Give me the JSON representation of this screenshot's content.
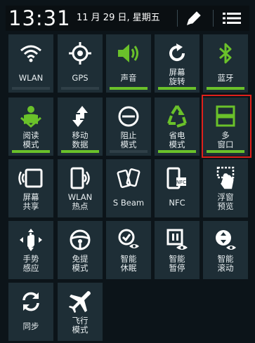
{
  "status": {
    "time": "13:31",
    "date": "11 月 29 日, 星期五"
  },
  "colors": {
    "active_bar": "#6ac12a",
    "inactive_bar": "#2f3f47",
    "tile_bg": "#1e2e36",
    "highlight": "#e0201b"
  },
  "tiles": [
    {
      "label": "WLAN",
      "icon": "wifi-icon",
      "active": false
    },
    {
      "label": "GPS",
      "icon": "gps-icon",
      "active": false
    },
    {
      "label": "声音",
      "icon": "sound-icon",
      "active": true
    },
    {
      "label": "屏幕\n旋转",
      "icon": "rotate-icon",
      "active": true
    },
    {
      "label": "蓝牙",
      "icon": "bluetooth-icon",
      "active": true
    },
    {
      "label": "阅读\n模式",
      "icon": "reading-icon",
      "active": true
    },
    {
      "label": "移动\n数据",
      "icon": "mobile-data-icon",
      "active": true
    },
    {
      "label": "阻止\n模式",
      "icon": "block-icon",
      "active": false
    },
    {
      "label": "省电\n模式",
      "icon": "recycle-icon",
      "active": true
    },
    {
      "label": "多\n窗口",
      "icon": "multi-window-icon",
      "active": true
    },
    {
      "label": "屏幕\n共享",
      "icon": "screen-share-icon",
      "active": false
    },
    {
      "label": "WLAN\n热点",
      "icon": "hotspot-icon",
      "active": false
    },
    {
      "label": "S Beam",
      "icon": "sbeam-icon",
      "active": false
    },
    {
      "label": "NFC",
      "icon": "nfc-icon",
      "active": false
    },
    {
      "label": "浮窗\n预览",
      "icon": "float-preview-icon",
      "active": false
    },
    {
      "label": "手势\n感应",
      "icon": "gesture-icon",
      "active": false
    },
    {
      "label": "免提\n模式",
      "icon": "handsfree-icon",
      "active": false
    },
    {
      "label": "智能\n休眠",
      "icon": "smart-stay-icon",
      "active": false
    },
    {
      "label": "智能\n暂停",
      "icon": "smart-pause-icon",
      "active": false
    },
    {
      "label": "智能\n滚动",
      "icon": "smart-scroll-icon",
      "active": false
    },
    {
      "label": "同步",
      "icon": "sync-icon",
      "active": false
    },
    {
      "label": "飞行\n模式",
      "icon": "airplane-icon",
      "active": false
    }
  ]
}
